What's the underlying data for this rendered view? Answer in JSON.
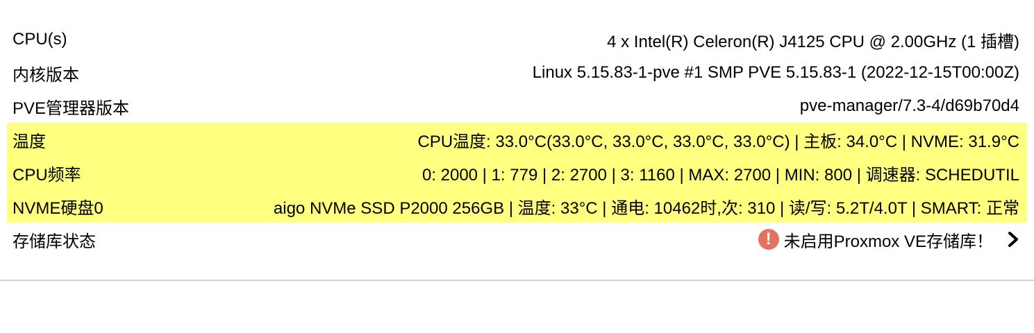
{
  "rows": [
    {
      "label": "CPU(s)",
      "value": "4 x Intel(R) Celeron(R) J4125 CPU @ 2.00GHz (1 插槽)"
    },
    {
      "label": "内核版本",
      "value": "Linux 5.15.83-1-pve #1 SMP PVE 5.15.83-1 (2022-12-15T00:00Z)"
    },
    {
      "label": "PVE管理器版本",
      "value": "pve-manager/7.3-4/d69b70d4"
    },
    {
      "label": "温度",
      "value": "CPU温度: 33.0°C(33.0°C, 33.0°C, 33.0°C, 33.0°C) | 主板: 34.0°C | NVME: 31.9°C"
    },
    {
      "label": "CPU频率",
      "value": "0: 2000 | 1: 779 | 2: 2700 | 3: 1160 | MAX: 2700 | MIN: 800 | 调速器: SCHEDUTIL"
    },
    {
      "label": "NVME硬盘0",
      "value": "aigo NVMe SSD P2000 256GB | 温度: 33°C | 通电: 10462时,次: 310 | 读/写: 5.2T/4.0T | SMART: 正常"
    }
  ],
  "storage": {
    "label": "存储库状态",
    "value": "未启用Proxmox VE存储库！",
    "icon": "exclamation-circle-icon",
    "icon_glyph": "!",
    "icon_color": "#e3735e",
    "chevron": "chevron-right-icon"
  },
  "colors": {
    "highlight": "#ffff80"
  }
}
